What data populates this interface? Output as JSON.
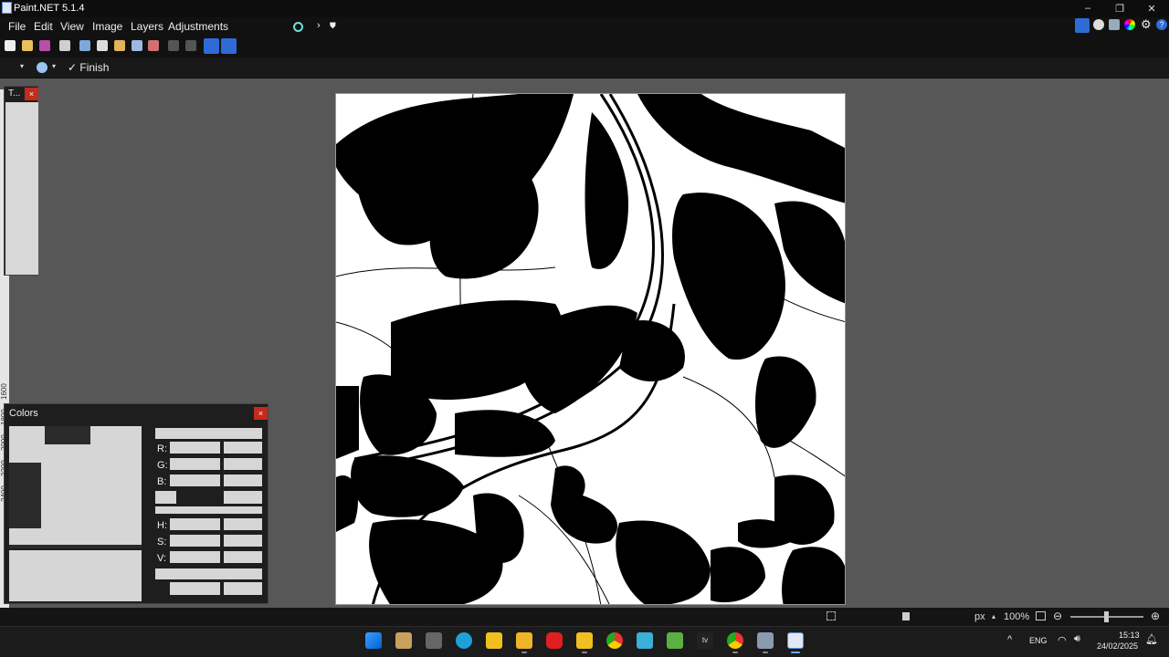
{
  "window": {
    "title": "Paint.NET 5.1.4"
  },
  "menu": [
    "File",
    "Edit",
    "View",
    "Image",
    "Layers",
    "Adjustments"
  ],
  "options_bar": {
    "finish_label": "Finish"
  },
  "tools_panel": {
    "title": "T..."
  },
  "rulers": {
    "vertical_labels": [
      "1600",
      "1800",
      "2000",
      "2200",
      "2400"
    ]
  },
  "colors_panel": {
    "title": "Colors",
    "labels": {
      "r": "R:",
      "g": "G:",
      "b": "B:",
      "h": "H:",
      "s": "S:",
      "v": "V:"
    }
  },
  "statusbar": {
    "units": "px",
    "zoom": "100%"
  },
  "taskbar": {
    "language": "ENG",
    "time": "15:13",
    "date": "24/02/2025"
  },
  "colors": {
    "accent": "#2f6bd6",
    "close_red": "#c42b1c",
    "workspace": "#575757"
  }
}
